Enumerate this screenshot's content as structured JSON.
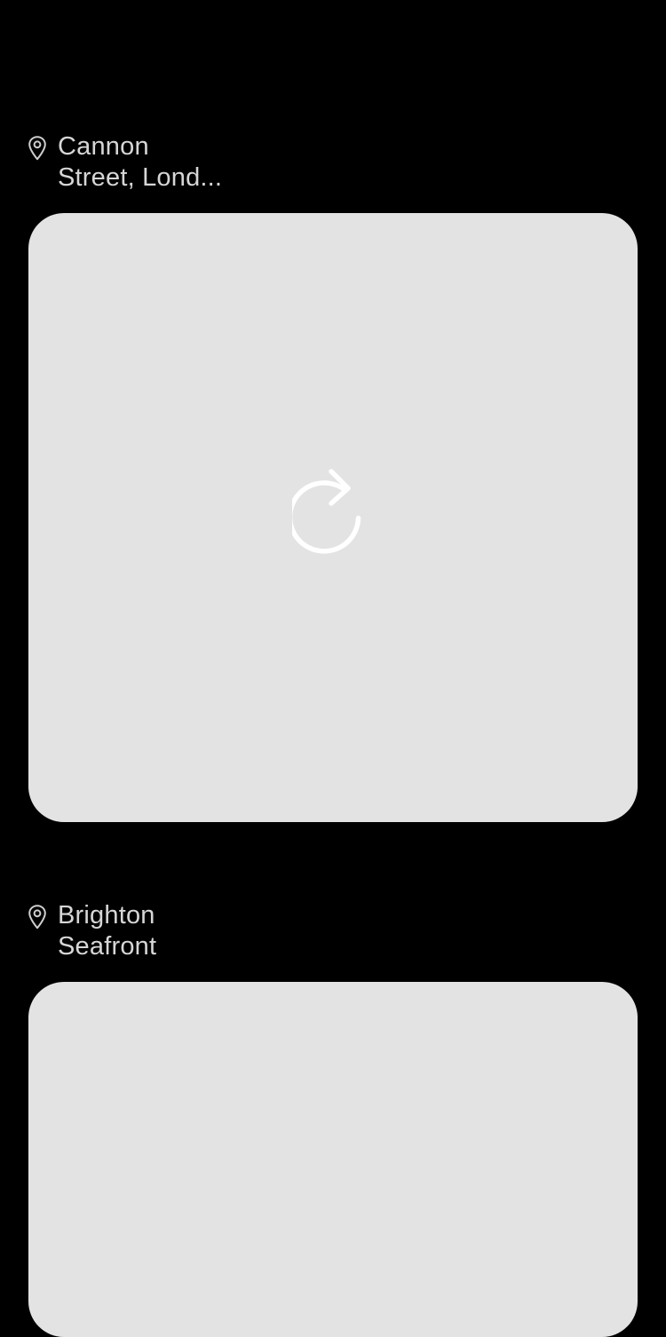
{
  "feed": {
    "posts": [
      {
        "location": "Cannon\nStreet, Lond...",
        "location_icon": "map-pin-icon",
        "media_state": "loading",
        "media_icon": "reload-icon",
        "media_background": "#e3e3e3"
      },
      {
        "location": "Brighton\nSeafront",
        "location_icon": "map-pin-icon",
        "media_state": "loading",
        "media_background": "#e3e3e3"
      }
    ]
  },
  "colors": {
    "background": "#000000",
    "label_text": "#d6d6d6",
    "placeholder": "#e3e3e3",
    "icon": "#ffffff"
  }
}
